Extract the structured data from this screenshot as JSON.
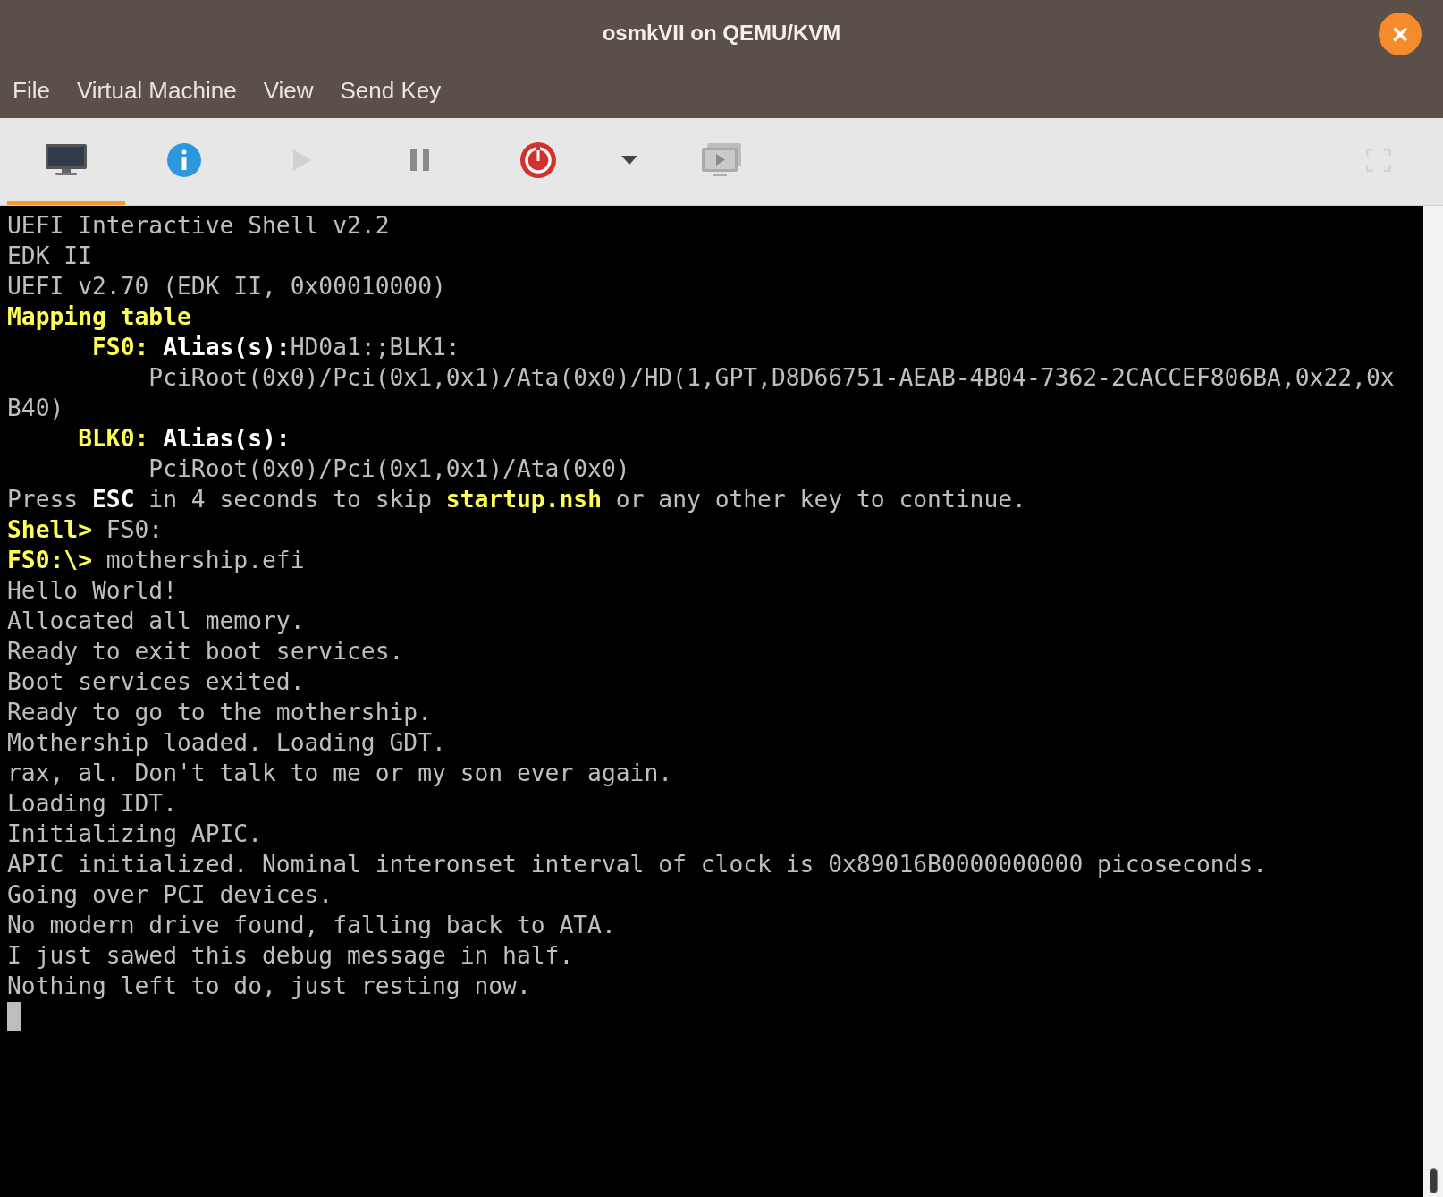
{
  "window": {
    "title": "osmkVII on QEMU/KVM",
    "close_label": "×"
  },
  "menu": [
    "File",
    "Virtual Machine",
    "View",
    "Send Key"
  ],
  "toolbar": [
    {
      "kind": "console",
      "selected": true,
      "disabled": false
    },
    {
      "kind": "details",
      "selected": false,
      "disabled": false
    },
    {
      "kind": "run",
      "selected": false,
      "disabled": true
    },
    {
      "kind": "pause",
      "selected": false,
      "disabled": false
    },
    {
      "kind": "shutdown",
      "selected": false,
      "disabled": false
    },
    {
      "kind": "dropdown",
      "selected": false,
      "disabled": false
    },
    {
      "kind": "screenshot",
      "selected": false,
      "disabled": false
    },
    {
      "kind": "fullscreen",
      "selected": false,
      "disabled": true
    }
  ],
  "terminal": {
    "cursor_visible": true,
    "lines": [
      [
        {
          "kind": "plain",
          "text": "UEFI Interactive Shell v2.2"
        }
      ],
      [
        {
          "kind": "plain",
          "text": "EDK II"
        }
      ],
      [
        {
          "kind": "plain",
          "text": "UEFI v2.70 (EDK II, 0x00010000)"
        }
      ],
      [
        {
          "kind": "yellow",
          "text": "Mapping table"
        }
      ],
      [
        {
          "kind": "yellow",
          "text": "      FS0: "
        },
        {
          "kind": "bright",
          "text": "Alias(s):"
        },
        {
          "kind": "plain",
          "text": "HD0a1:;BLK1:"
        }
      ],
      [
        {
          "kind": "plain",
          "text": "          PciRoot(0x0)/Pci(0x1,0x1)/Ata(0x0)/HD(1,GPT,D8D66751-AEAB-4B04-7362-2CACCEF806BA,0x22,0x"
        }
      ],
      [
        {
          "kind": "plain",
          "text": "B40)"
        }
      ],
      [
        {
          "kind": "yellow",
          "text": "     BLK0: "
        },
        {
          "kind": "bright",
          "text": "Alias(s):"
        }
      ],
      [
        {
          "kind": "plain",
          "text": "          PciRoot(0x0)/Pci(0x1,0x1)/Ata(0x0)"
        }
      ],
      [
        {
          "kind": "plain",
          "text": "Press "
        },
        {
          "kind": "bright",
          "text": "ESC"
        },
        {
          "kind": "plain",
          "text": " in 4 seconds to skip "
        },
        {
          "kind": "yellow",
          "text": "startup.nsh"
        },
        {
          "kind": "plain",
          "text": " or any other key to continue."
        }
      ],
      [
        {
          "kind": "yellow",
          "text": "Shell> "
        },
        {
          "kind": "plain",
          "text": "FS0:"
        }
      ],
      [
        {
          "kind": "yellow",
          "text": "FS0:\\> "
        },
        {
          "kind": "plain",
          "text": "mothership.efi"
        }
      ],
      [
        {
          "kind": "plain",
          "text": "Hello World!"
        }
      ],
      [
        {
          "kind": "plain",
          "text": "Allocated all memory."
        }
      ],
      [
        {
          "kind": "plain",
          "text": "Ready to exit boot services."
        }
      ],
      [
        {
          "kind": "plain",
          "text": "Boot services exited."
        }
      ],
      [
        {
          "kind": "plain",
          "text": "Ready to go to the mothership."
        }
      ],
      [
        {
          "kind": "plain",
          "text": "Mothership loaded. Loading GDT."
        }
      ],
      [
        {
          "kind": "plain",
          "text": "rax, al. Don't talk to me or my son ever again."
        }
      ],
      [
        {
          "kind": "plain",
          "text": "Loading IDT."
        }
      ],
      [
        {
          "kind": "plain",
          "text": "Initializing APIC."
        }
      ],
      [
        {
          "kind": "plain",
          "text": "APIC initialized. Nominal interonset interval of clock is 0x89016B0000000000 picoseconds."
        }
      ],
      [
        {
          "kind": "plain",
          "text": "Going over PCI devices."
        }
      ],
      [
        {
          "kind": "plain",
          "text": "No modern drive found, falling back to ATA."
        }
      ],
      [
        {
          "kind": "plain",
          "text": "I just sawed this debug message in half."
        }
      ],
      [
        {
          "kind": "plain",
          "text": "Nothing left to do, just resting now."
        }
      ]
    ]
  }
}
